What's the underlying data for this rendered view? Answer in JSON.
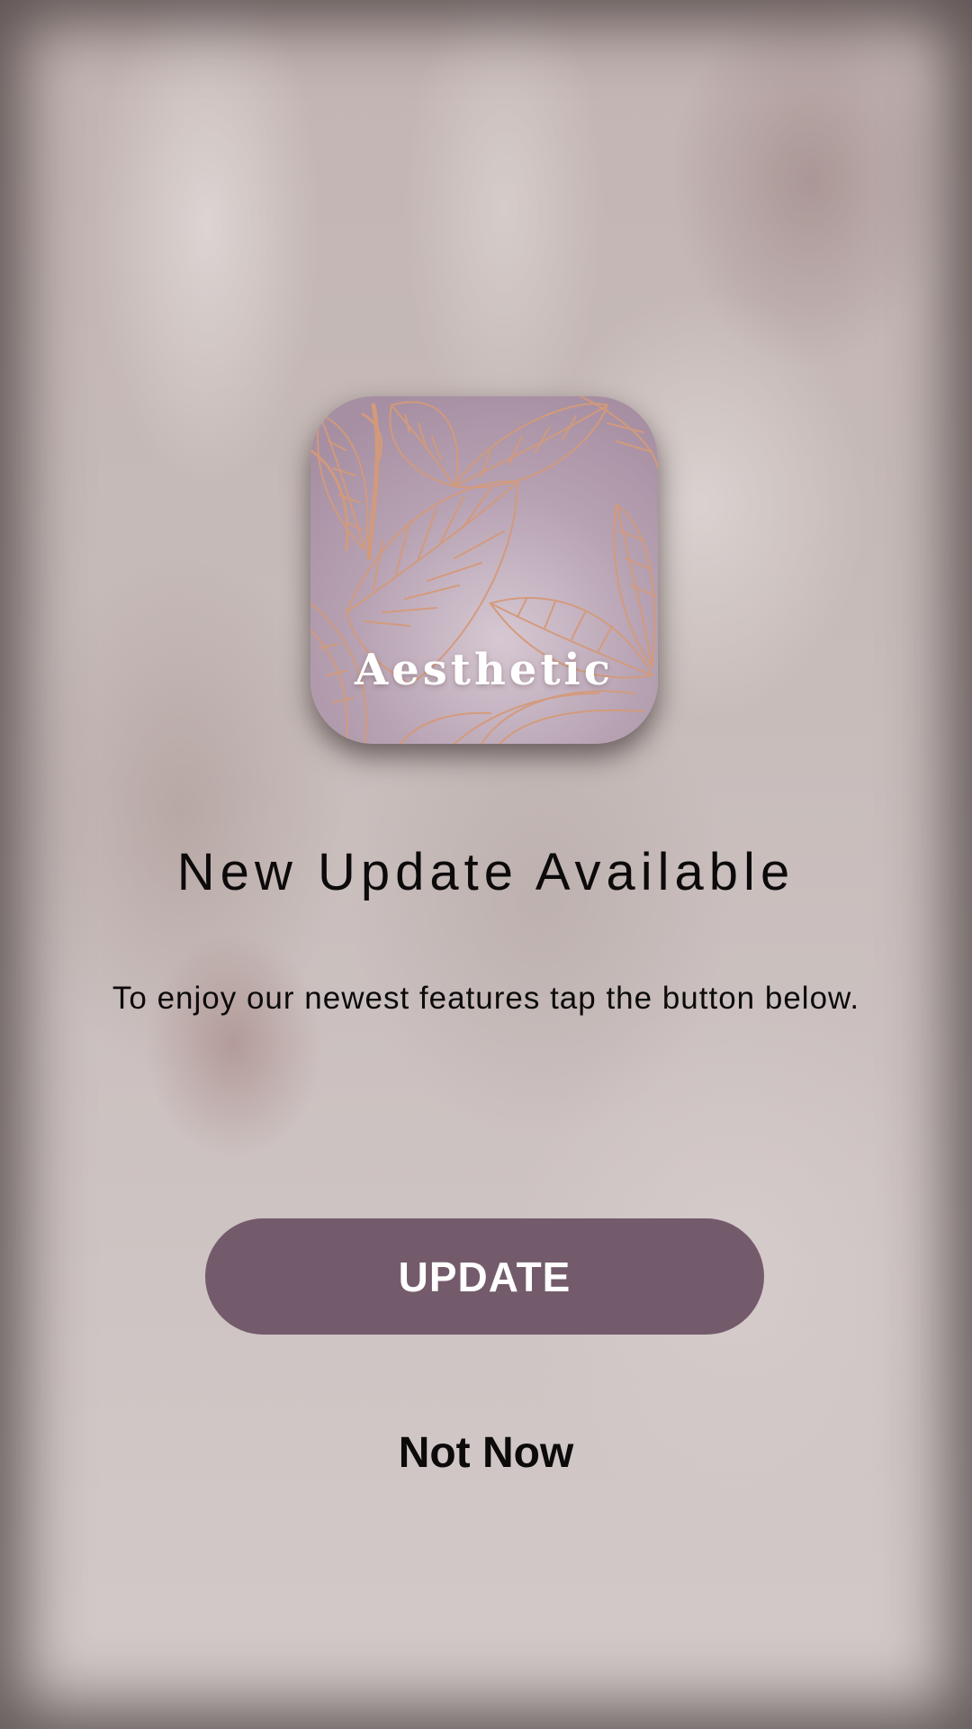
{
  "app_icon": {
    "label": "Aesthetic",
    "icon": "leaf-pattern-app-icon",
    "colors": {
      "base": "#b8a3b4",
      "leaf_line": "#d49a7a"
    }
  },
  "dialog": {
    "title": "New Update Available",
    "message": "To enjoy our newest features tap the button below.",
    "update_label": "UPDATE",
    "not_now_label": "Not Now"
  },
  "colors": {
    "accent": "#745b6b",
    "text": "#0c0a0a",
    "button_text": "#ffffff"
  }
}
